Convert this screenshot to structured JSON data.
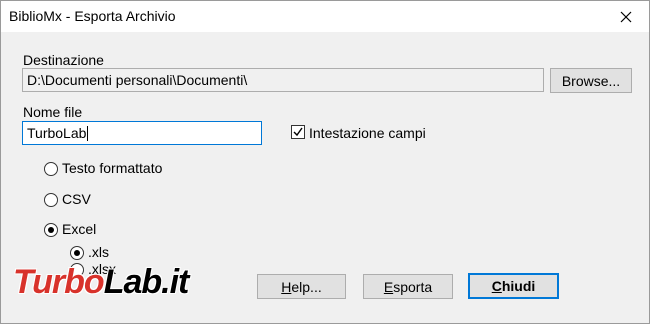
{
  "window": {
    "title": "BiblioMx - Esporta Archivio"
  },
  "destination": {
    "label": "Destinazione",
    "path": "D:\\Documenti personali\\Documenti\\",
    "browse_label": "Browse..."
  },
  "filename": {
    "label": "Nome file",
    "value": "TurboLab"
  },
  "header_checkbox": {
    "label": "Intestazione campi",
    "checked": true
  },
  "format_options": [
    {
      "label": "Testo formattato",
      "selected": false
    },
    {
      "label": "CSV",
      "selected": false
    },
    {
      "label": "Excel",
      "selected": true
    }
  ],
  "excel_options": [
    {
      "label": ".xls",
      "selected": true
    },
    {
      "label": ".xlsx",
      "selected": false
    }
  ],
  "buttons": {
    "help_underline": "H",
    "help_rest": "elp...",
    "export_underline": "E",
    "export_rest": "sporta",
    "close_underline": "C",
    "close_rest": "hiudi"
  },
  "watermark": {
    "part1": "Turbo",
    "part2": "Lab.it"
  },
  "icons": {
    "close": "close-icon"
  }
}
